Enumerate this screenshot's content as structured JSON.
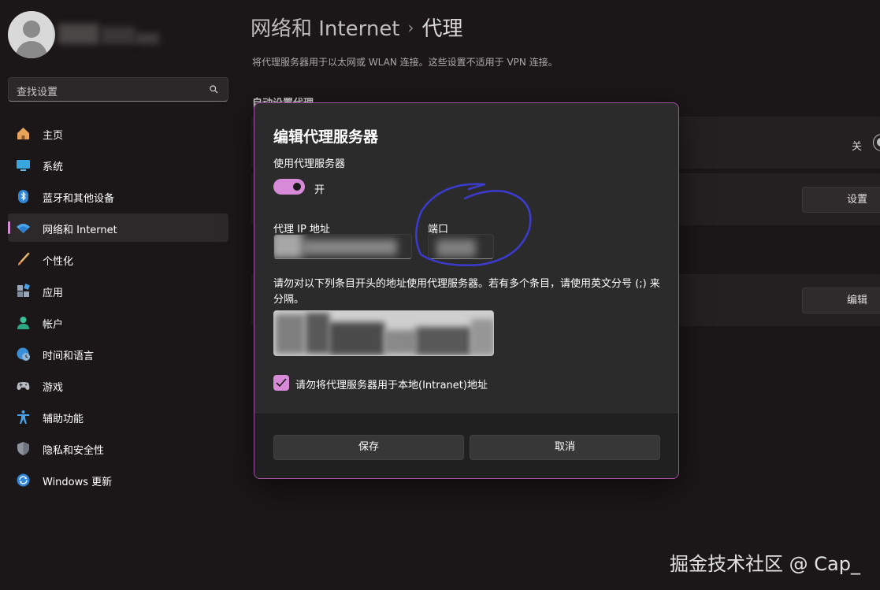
{
  "sidebar": {
    "search_placeholder": "查找设置",
    "items": [
      {
        "label": "主页",
        "icon": "home-icon"
      },
      {
        "label": "系统",
        "icon": "monitor-icon"
      },
      {
        "label": "蓝牙和其他设备",
        "icon": "bluetooth-icon"
      },
      {
        "label": "网络和 Internet",
        "icon": "wifi-icon",
        "active": true
      },
      {
        "label": "个性化",
        "icon": "brush-icon"
      },
      {
        "label": "应用",
        "icon": "apps-icon"
      },
      {
        "label": "帐户",
        "icon": "person-icon"
      },
      {
        "label": "时间和语言",
        "icon": "globe-clock-icon"
      },
      {
        "label": "游戏",
        "icon": "gamepad-icon"
      },
      {
        "label": "辅助功能",
        "icon": "accessibility-icon"
      },
      {
        "label": "隐私和安全性",
        "icon": "shield-icon"
      },
      {
        "label": "Windows 更新",
        "icon": "update-icon"
      }
    ]
  },
  "header": {
    "breadcrumb_parent": "网络和 Internet",
    "breadcrumb_sep": "›",
    "breadcrumb_current": "代理",
    "description": "将代理服务器用于以太网或 WLAN 连接。这些设置不适用于 VPN 连接。",
    "section_label": "自动设置代理"
  },
  "background": {
    "auto_detect_state": "关",
    "setup_button": "设置",
    "edit_button": "编辑"
  },
  "dialog": {
    "title": "编辑代理服务器",
    "use_proxy_label": "使用代理服务器",
    "toggle_state": "开",
    "ip_label": "代理 IP 地址",
    "port_label": "端口",
    "exceptions_description": "请勿对以下列条目开头的地址使用代理服务器。若有多个条目，请使用英文分号 (;) 来分隔。",
    "local_checkbox_label": "请勿将代理服务器用于本地(Intranet)地址",
    "local_checkbox_checked": true,
    "save_button": "保存",
    "cancel_button": "取消"
  },
  "watermark": "掘金技术社区 @ Cap_",
  "colors": {
    "accent": "#d78ad7",
    "dialog_border": "#a352a3",
    "annotation": "#3b3bd0",
    "background": "#1b1718"
  }
}
